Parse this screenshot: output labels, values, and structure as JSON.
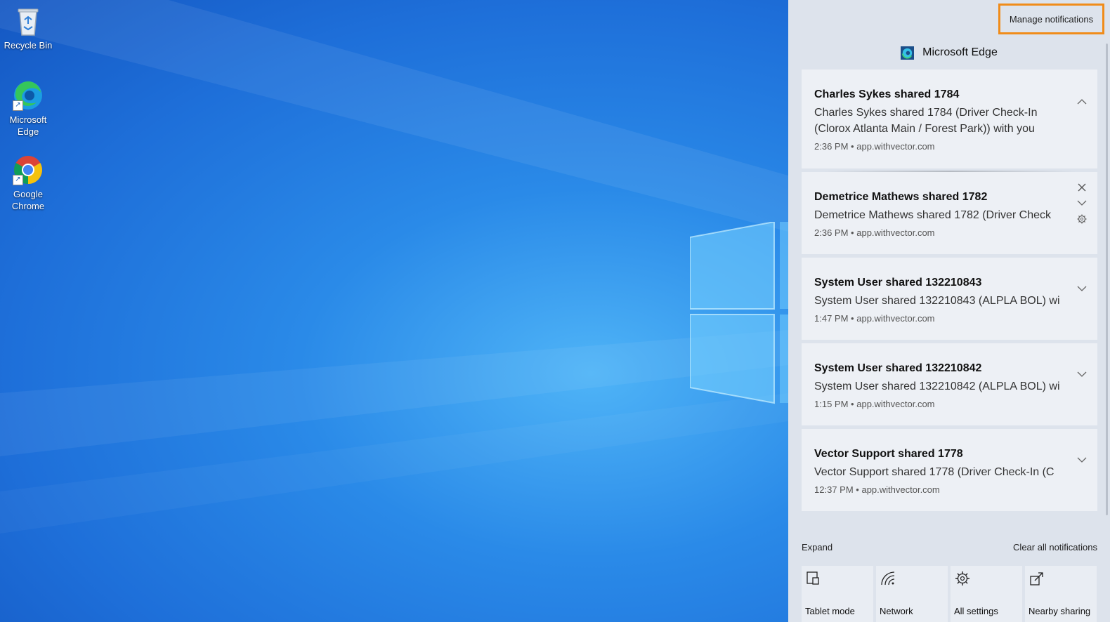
{
  "desktop": {
    "icons": [
      {
        "label": "Recycle Bin",
        "icon": "recycle-bin-icon"
      },
      {
        "label": "Microsoft Edge",
        "icon": "edge-icon"
      },
      {
        "label": "Google Chrome",
        "icon": "chrome-icon"
      }
    ]
  },
  "action_center": {
    "manage_label": "Manage notifications",
    "app_name": "Microsoft Edge",
    "notifications": [
      {
        "title": "Charles Sykes shared 1784",
        "body": "Charles Sykes shared 1784 (Driver Check-In (Clorox Atlanta Main / Forest Park)) with you",
        "time": "2:36 PM",
        "source": "app.withvector.com",
        "expanded": true
      },
      {
        "title": "Demetrice Mathews shared 1782",
        "body": "Demetrice Mathews shared 1782 (Driver Check",
        "time": "2:36 PM",
        "source": "app.withvector.com",
        "expanded": false
      },
      {
        "title": "System User shared 132210843",
        "body": "System User shared 132210843 (ALPLA BOL) wi",
        "time": "1:47 PM",
        "source": "app.withvector.com",
        "expanded": false
      },
      {
        "title": "System User shared 132210842",
        "body": "System User shared 132210842 (ALPLA BOL) wi",
        "time": "1:15 PM",
        "source": "app.withvector.com",
        "expanded": false
      },
      {
        "title": "Vector Support shared 1778",
        "body": "Vector Support shared 1778 (Driver Check-In (C",
        "time": "12:37 PM",
        "source": "app.withvector.com",
        "expanded": false
      }
    ],
    "separator": "•",
    "expand_label": "Expand",
    "clear_label": "Clear all notifications",
    "tiles": [
      {
        "label": "Tablet mode",
        "icon": "tablet-mode-icon"
      },
      {
        "label": "Network",
        "icon": "network-icon"
      },
      {
        "label": "All settings",
        "icon": "settings-icon"
      },
      {
        "label": "Nearby sharing",
        "icon": "nearby-sharing-icon"
      }
    ]
  },
  "colors": {
    "highlight": "#f08c1a",
    "panel_bg": "#dde3ec",
    "card_bg": "#edf0f5"
  }
}
